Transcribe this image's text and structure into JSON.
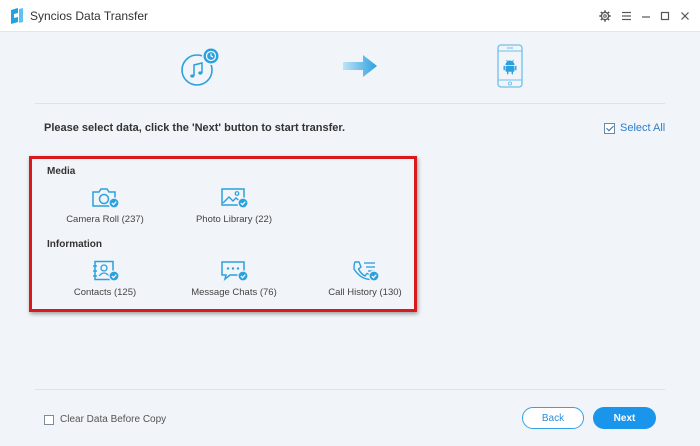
{
  "window": {
    "title": "Syncios Data Transfer",
    "icons": [
      "syncios-logo-icon",
      "gear-icon",
      "menu-icon",
      "minimize-icon",
      "maximize-icon",
      "close-icon"
    ]
  },
  "hero": {
    "source_icon": "itunes-backup-icon",
    "arrow_icon": "arrow-right-icon",
    "target_icon": "android-phone-icon"
  },
  "main": {
    "instruction": "Please select data, click the 'Next' button to start transfer.",
    "select_all_label": "Select All",
    "sections": [
      {
        "label": "Media",
        "items": [
          {
            "label": "Camera Roll (237)",
            "icon": "camera-icon"
          },
          {
            "label": "Photo Library (22)",
            "icon": "photo-icon"
          }
        ]
      },
      {
        "label": "Information",
        "items": [
          {
            "label": "Contacts (125)",
            "icon": "contacts-icon"
          },
          {
            "label": "Message Chats (76)",
            "icon": "message-icon"
          },
          {
            "label": "Call History (130)",
            "icon": "call-history-icon"
          }
        ]
      }
    ]
  },
  "footer": {
    "clear_data_label": "Clear Data Before Copy",
    "back_label": "Back",
    "next_label": "Next"
  },
  "colors": {
    "accent": "#1a95ec",
    "highlight": "#d9191b",
    "icon_blue": "#2aa1de",
    "background": "#f1f4f8"
  }
}
